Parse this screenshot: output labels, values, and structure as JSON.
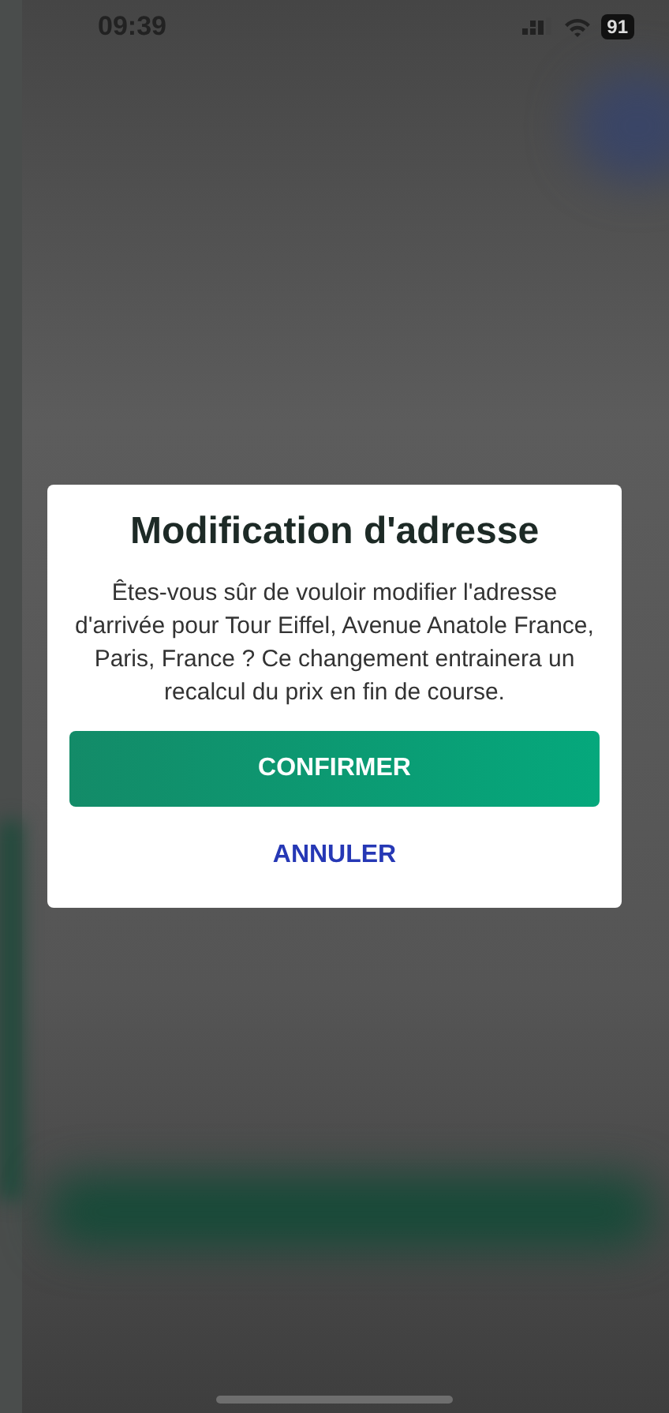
{
  "status_bar": {
    "time": "09:39",
    "battery": "91"
  },
  "dialog": {
    "title": "Modification d'adresse",
    "message": "Êtes-vous sûr de vouloir modifier l'adresse d'arrivée pour Tour Eiffel, Avenue Anatole France, Paris, France ? Ce changement entrainera un recalcul du prix en fin de course.",
    "buttons": [
      {
        "label": "CONFIRMER",
        "kind": "primary"
      },
      {
        "label": "ANNULER",
        "kind": "text"
      }
    ]
  }
}
